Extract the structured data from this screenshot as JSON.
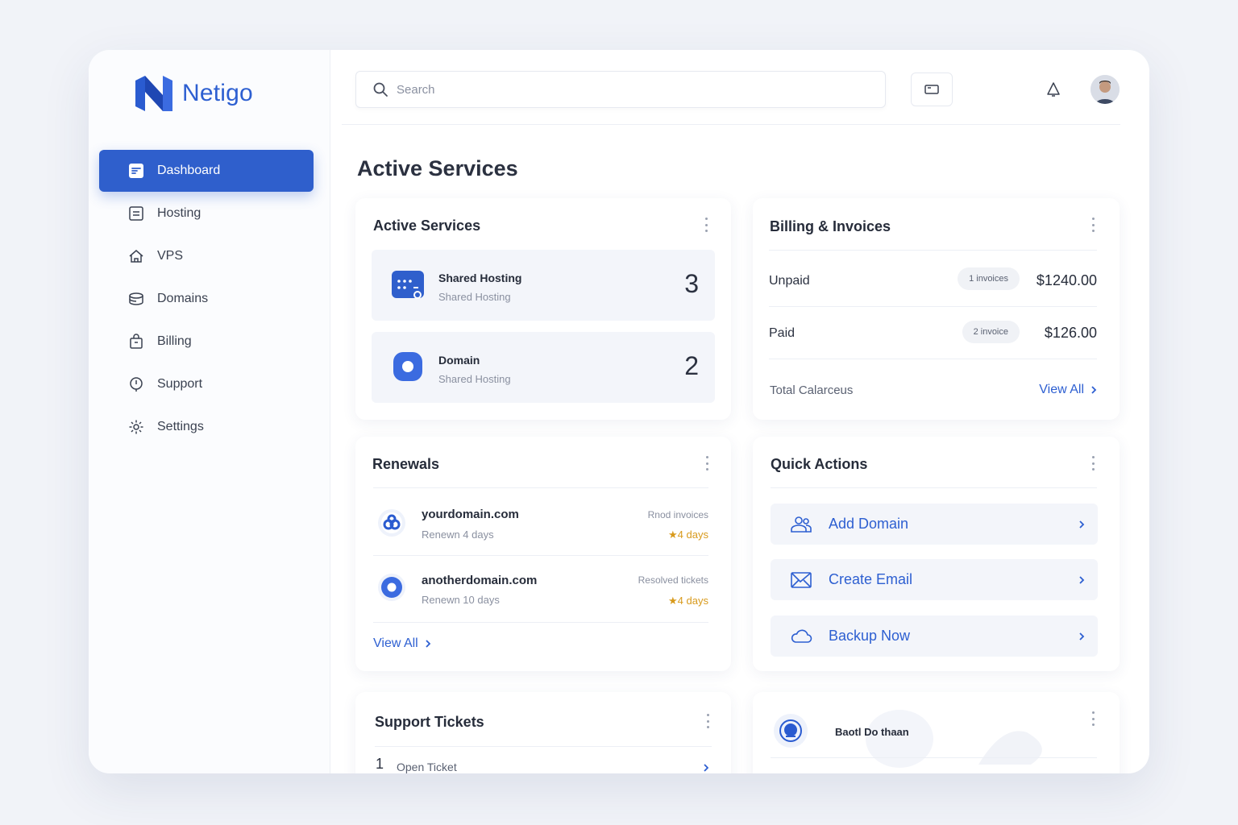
{
  "app": {
    "name": "Netigo"
  },
  "sidebar": {
    "items": [
      {
        "label": "Dashboard",
        "icon": "dashboard-icon",
        "active": true
      },
      {
        "label": "Hosting",
        "icon": "hosting-icon"
      },
      {
        "label": "VPS",
        "icon": "vps-icon"
      },
      {
        "label": "Domains",
        "icon": "domains-icon"
      },
      {
        "label": "Billing",
        "icon": "billing-icon"
      },
      {
        "label": "Support",
        "icon": "support-icon"
      },
      {
        "label": "Settings",
        "icon": "settings-icon"
      }
    ]
  },
  "header": {
    "search_placeholder": "Search"
  },
  "page": {
    "title": "Active Services"
  },
  "active_services": {
    "title": "Active Services",
    "items": [
      {
        "name": "Shared Hosting",
        "sub": "Shared Hosting",
        "count": "3"
      },
      {
        "name": "Domain",
        "sub": "Shared Hosting",
        "count": "2"
      }
    ]
  },
  "billing": {
    "title": "Billing & Invoices",
    "rows": [
      {
        "label": "Unpaid",
        "pill": "1 invoices",
        "amount": "$1240.00"
      },
      {
        "label": "Paid",
        "pill": "2 invoice",
        "amount": "$126.00"
      }
    ],
    "total_label": "Total Calarceus",
    "view_all": "View All"
  },
  "renewals": {
    "title": "Renewals",
    "items": [
      {
        "domain": "yourdomain.com",
        "renew": "Renewn 4 days",
        "status": "Rnod invoices",
        "days": "★4 days"
      },
      {
        "domain": "anotherdomain.com",
        "renew": "Renewn 10 days",
        "status": "Resolved tickets",
        "days": "★4 days"
      }
    ],
    "view_all": "View All"
  },
  "quick_actions": {
    "title": "Quick Actions",
    "items": [
      {
        "label": "Add Domain",
        "icon": "users-icon"
      },
      {
        "label": "Create Email",
        "icon": "email-icon"
      },
      {
        "label": "Backup Now",
        "icon": "cloud-icon"
      }
    ]
  },
  "support": {
    "title": "Support Tickets",
    "row": {
      "num": "1",
      "label": "Open Ticket"
    }
  },
  "extra_card": {
    "label": "Baotl Do thaan"
  },
  "colors": {
    "accent": "#2f5fcc",
    "warning": "#d89a1c"
  }
}
